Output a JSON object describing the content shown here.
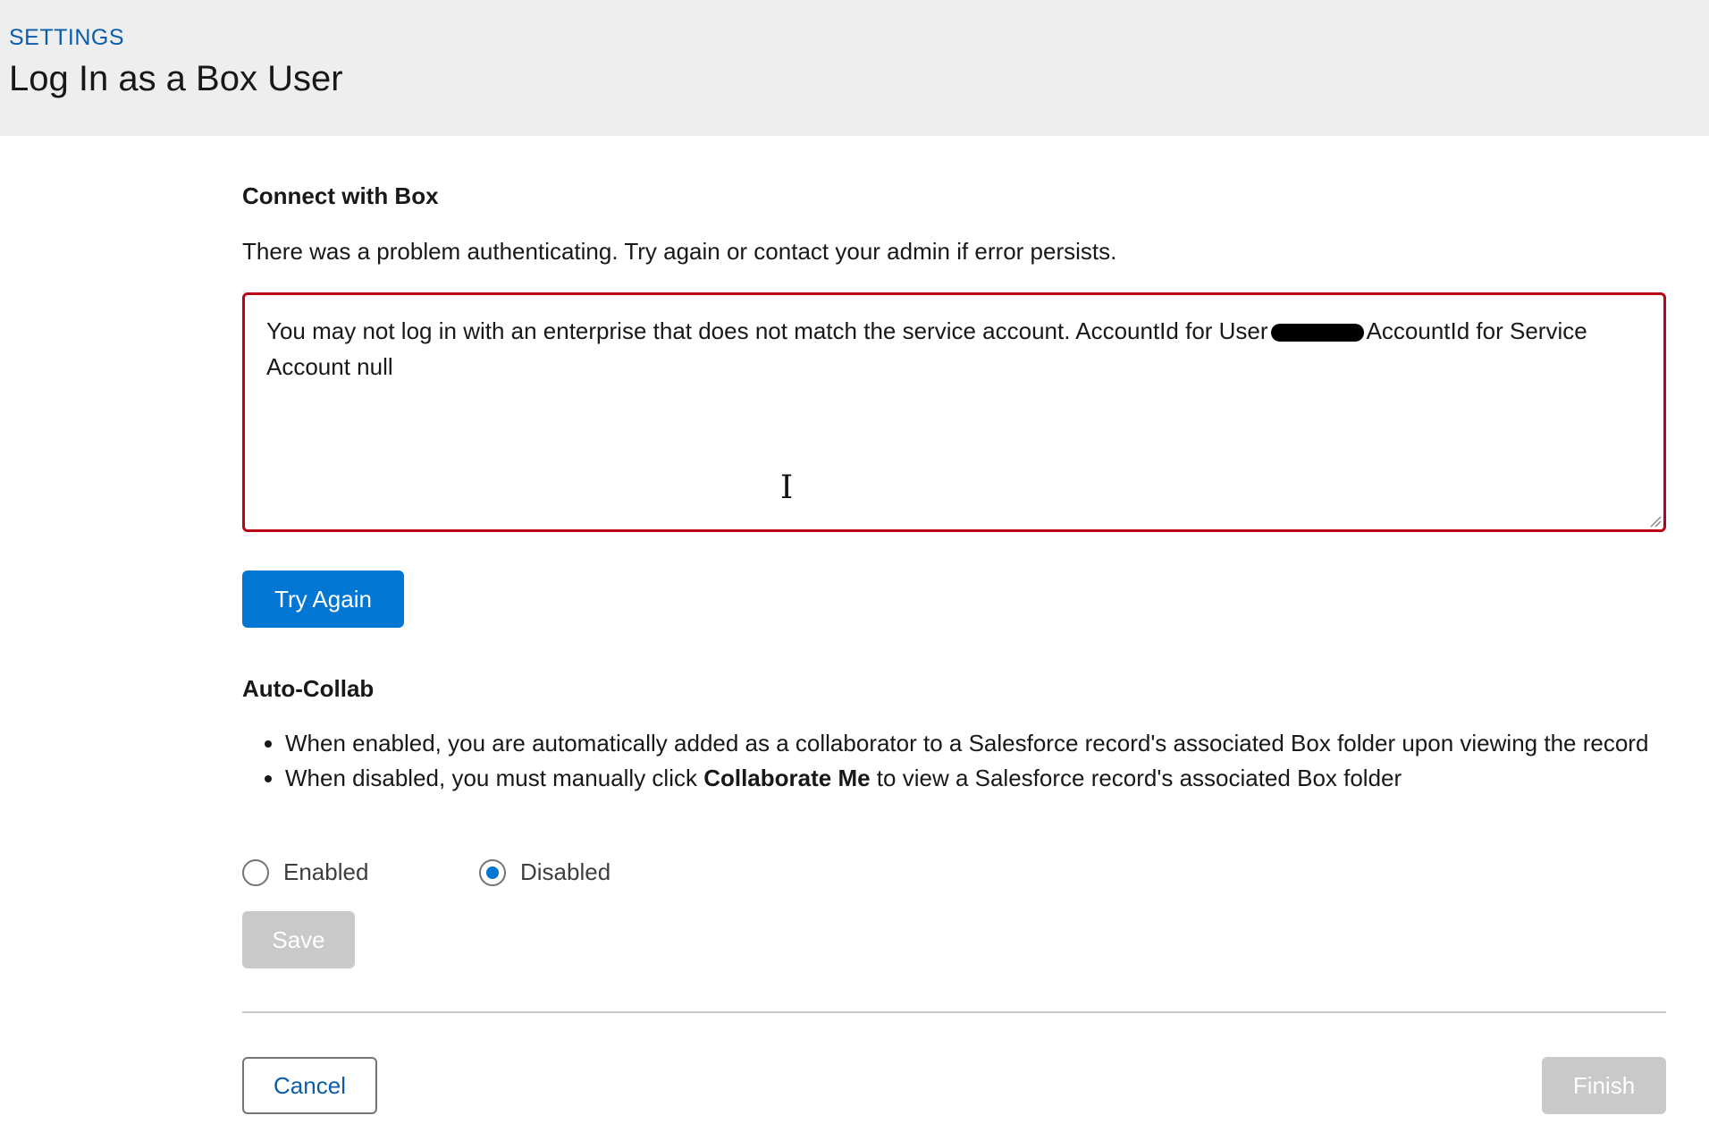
{
  "header": {
    "eyebrow": "SETTINGS",
    "title": "Log In as a Box User"
  },
  "connect": {
    "title": "Connect with Box",
    "message": "There was a problem authenticating. Try again or contact your admin if error persists.",
    "error_text_before": "You may not log in with an enterprise that does not match the service account. AccountId for User",
    "error_text_after": "AccountId for Service Account null",
    "try_again_label": "Try Again"
  },
  "auto_collab": {
    "title": "Auto-Collab",
    "bullet_1": "When enabled, you are automatically added as a collaborator to a Salesforce record's associated Box folder upon viewing the record",
    "bullet_2_before": "When disabled, you must manually click ",
    "bullet_2_bold": "Collaborate Me",
    "bullet_2_after": " to view a Salesforce record's associated Box folder",
    "options": [
      {
        "label": "Enabled",
        "selected": false
      },
      {
        "label": "Disabled",
        "selected": true
      }
    ],
    "save_label": "Save"
  },
  "footer": {
    "cancel_label": "Cancel",
    "finish_label": "Finish"
  },
  "colors": {
    "brand_blue": "#0176d3",
    "link_blue": "#0b5cab",
    "error_red": "#ba0517",
    "disabled_gray": "#c9c9c9"
  },
  "icons": {
    "cursor": "text-cursor-icon",
    "resize": "resize-handle-icon"
  }
}
